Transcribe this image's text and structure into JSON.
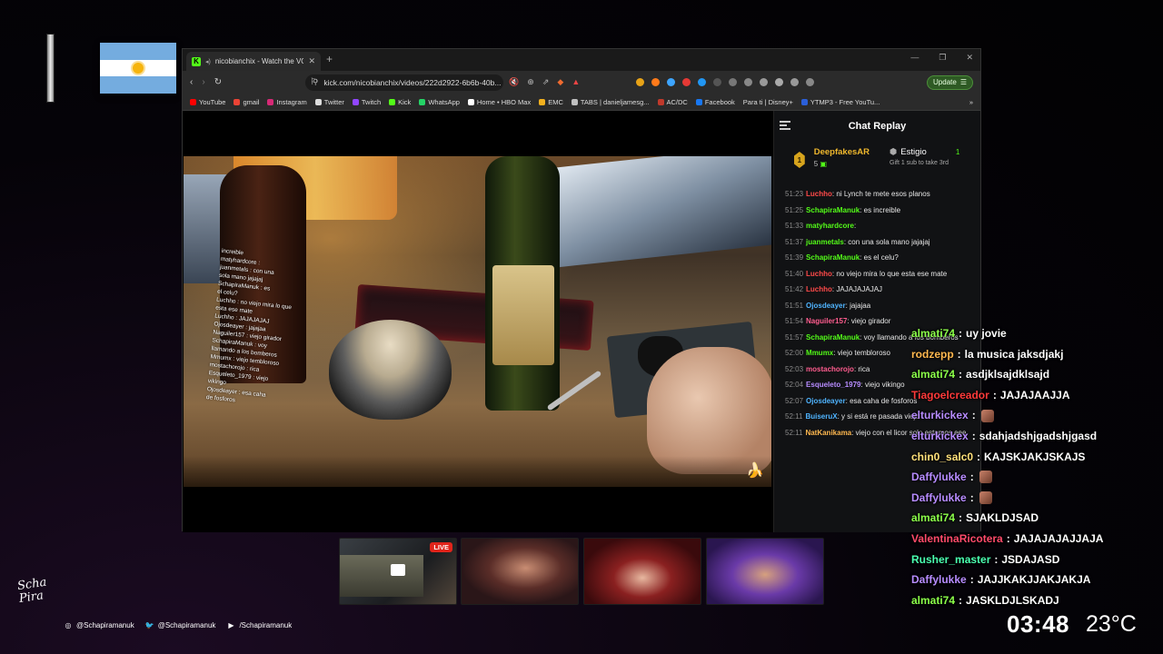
{
  "browser": {
    "tab_title": "nicobianchix - Watch the VOD",
    "url": "kick.com/nicobianchix/videos/222d2922-6b6b-40b...",
    "update_label": "Update",
    "bookmarks": [
      "YouTube",
      "gmail",
      "Instagram",
      "Twitter",
      "Twitch",
      "Kick",
      "WhatsApp",
      "Home • HBO Max",
      "EMC",
      "TABS | danieljamesg...",
      "AC/DC",
      "Facebook",
      "Para ti | Disney+",
      "YTMP3 - Free YouTu..."
    ]
  },
  "chat_replay": {
    "title": "Chat Replay",
    "leaderboard": {
      "rank1": "1",
      "top_user": "DeepfakesAR",
      "top_count": "5",
      "second_user": "Estigio",
      "second_count": "1",
      "second_sub": "Gift 1 sub to take 3rd"
    },
    "messages": [
      {
        "time": "51:23",
        "user": "Luchho",
        "color": "#ff4a4a",
        "text": "ni Lynch te mete esos planos"
      },
      {
        "time": "51:25",
        "user": "SchapiraManuk",
        "color": "#53fc18",
        "text": "es increible"
      },
      {
        "time": "51:33",
        "user": "matyhardcore",
        "color": "#53fc18",
        "text": ""
      },
      {
        "time": "51:37",
        "user": "juanmetals",
        "color": "#53fc18",
        "text": "con una sola mano jajajaj"
      },
      {
        "time": "51:39",
        "user": "SchapiraManuk",
        "color": "#53fc18",
        "text": "es el celu?"
      },
      {
        "time": "51:40",
        "user": "Luchho",
        "color": "#ff4a4a",
        "text": "no viejo mira lo que esta ese mate"
      },
      {
        "time": "51:42",
        "user": "Luchho",
        "color": "#ff4a4a",
        "text": "JAJAJAJAJAJ"
      },
      {
        "time": "51:51",
        "user": "Ojosdeayer",
        "color": "#4fb4ff",
        "text": "jajajaa"
      },
      {
        "time": "51:54",
        "user": "Naguiler157",
        "color": "#ff5d8f",
        "text": "viejo girador"
      },
      {
        "time": "51:57",
        "user": "SchapiraManuk",
        "color": "#53fc18",
        "text": "voy llamando a los bomberos"
      },
      {
        "time": "52:00",
        "user": "Mmumx",
        "color": "#53fc18",
        "text": "viejo tembloroso"
      },
      {
        "time": "52:03",
        "user": "mostachorojo",
        "color": "#ff5d8f",
        "text": "rica"
      },
      {
        "time": "52:04",
        "user": "Esqueleto_1979",
        "color": "#b78cff",
        "text": "viejo vikingo"
      },
      {
        "time": "52:07",
        "user": "Ojosdeayer",
        "color": "#4fb4ff",
        "text": "esa caha de fosforos"
      },
      {
        "time": "52:11",
        "user": "BuiseruX",
        "color": "#4fb4ff",
        "text": "y si está re pasada viejo"
      },
      {
        "time": "52:11",
        "user": "NatKanikama",
        "color": "#ffb84f",
        "text": "viejo con el licor solo estamos eee"
      }
    ]
  },
  "video_overlay_chat": [
    "increible",
    "matyhardcore :",
    "juanmetals : con una",
    "sola mano jajajaj",
    "SchapiraManuk : es",
    "el celu?",
    "Luchho : no viejo mira lo que",
    "esta ese mate",
    "Luchho : JAJAJAJAJ",
    "Ojosdeayer : jajajaa",
    "Naguiler157 : viejo girador",
    "SchapiraManuk : voy",
    "llamando a los bomberos",
    "Mmumx : viejo tembloroso",
    "mostachorojo : rica",
    "Esqueleto_1979 : viejo",
    "vikingo",
    "Ojosdeayer : esa caha",
    "de fosforos"
  ],
  "stream_chat": [
    {
      "user": "almati74",
      "color": "#8cff4a",
      "text": "uy jovie"
    },
    {
      "user": "rodzepp",
      "color": "#ffb84f",
      "text": "la musica jaksdjakj"
    },
    {
      "user": "almati74",
      "color": "#8cff4a",
      "text": "asdjklsajdklsajd"
    },
    {
      "user": "Tiagoelcreador",
      "color": "#ff3a3a",
      "text": "JAJAJAAJJA"
    },
    {
      "user": "elturkickex",
      "color": "#b78cff",
      "text": ""
    },
    {
      "user": "elturkickex",
      "color": "#b78cff",
      "text": "sdahjadshjgadshjgasd"
    },
    {
      "user": "chin0_salc0",
      "color": "#ffe07a",
      "text": "KAJSKJAKJSKAJS"
    },
    {
      "user": "Daffylukke",
      "color": "#b78cff",
      "text": ""
    },
    {
      "user": "Daffylukke",
      "color": "#b78cff",
      "text": ""
    },
    {
      "user": "almati74",
      "color": "#8cff4a",
      "text": "SJAKLDJSAD"
    },
    {
      "user": "ValentinaRicotera",
      "color": "#ff4a6a",
      "text": "JAJAJAJAJJAJA"
    },
    {
      "user": "Rusher_master",
      "color": "#4affb0",
      "text": "JSDAJASD"
    },
    {
      "user": "Daffylukke",
      "color": "#b78cff",
      "text": "JAJJKAKJJAKJAKJA"
    },
    {
      "user": "almati74",
      "color": "#8cff4a",
      "text": "JASKLDJLSKADJ"
    }
  ],
  "thumbnails": {
    "live_label": "LIVE"
  },
  "footer": {
    "logo_text": "Scha Pira",
    "instagram": "@Schapiramanuk",
    "twitter": "@Schapiramanuk",
    "youtube": "/Schapiramanuk",
    "clock": "03:48",
    "temperature": "23°C"
  }
}
